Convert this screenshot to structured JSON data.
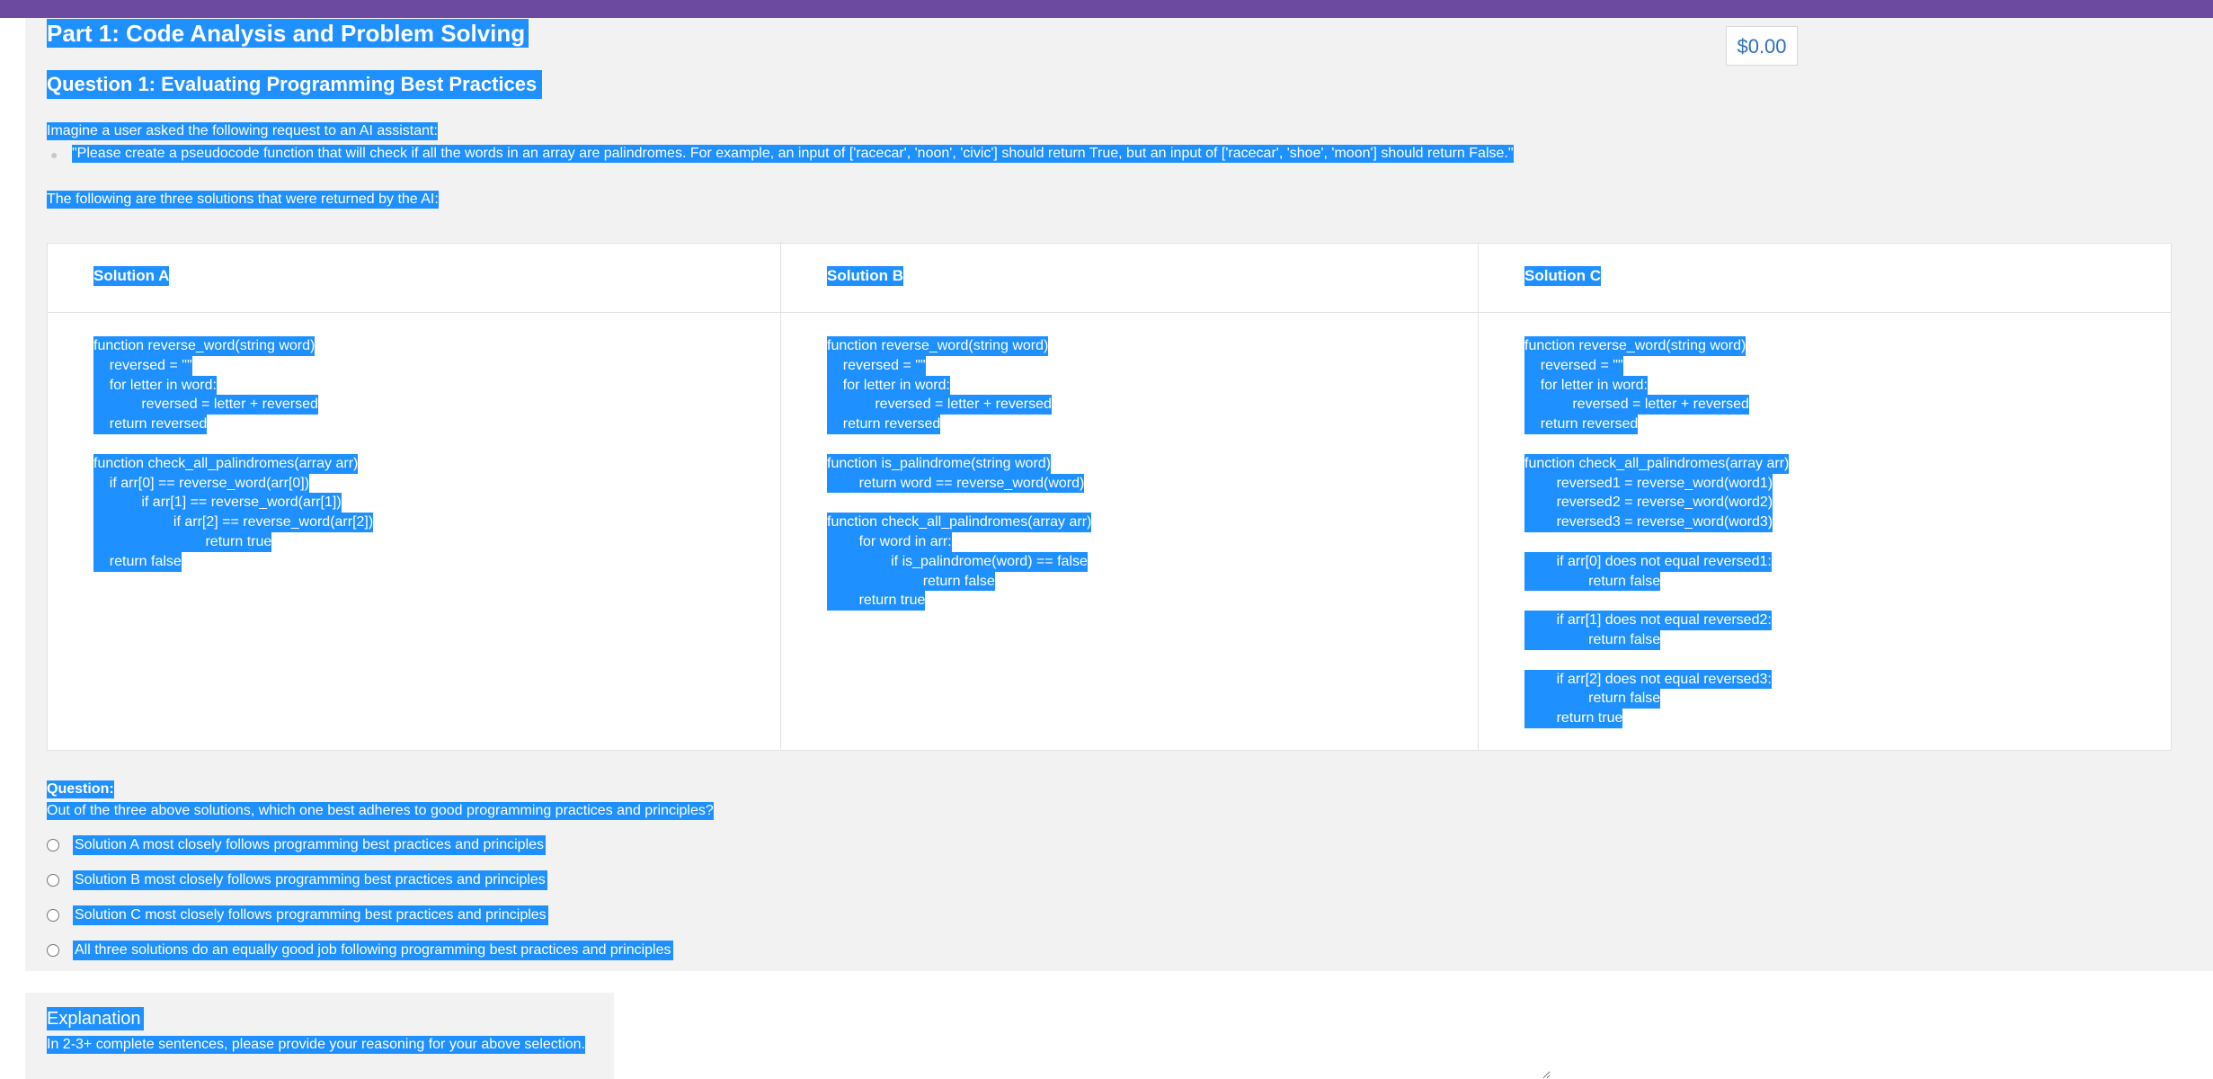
{
  "part_title": "Part 1: Code Analysis and Problem Solving",
  "price": "$0.00",
  "question_title": "Question 1: Evaluating Programming Best Practices",
  "intro": "Imagine a user asked the following request to an AI assistant:",
  "request_quote": "\"Please create a pseudocode function that will check if all the words in an array are palindromes. For example, an input of ['racecar', 'noon', 'civic'] should return True, but an input of ['racecar', 'shoe', 'moon'] should return False.\"",
  "following": "The following are three solutions that were returned by the AI:",
  "solutions": [
    {
      "title": "Solution A",
      "lines": [
        "function reverse_word(string word)",
        "    reversed = \"\"",
        "    for letter in word:",
        "            reversed = letter + reversed",
        "    return reversed",
        "",
        "function check_all_palindromes(array arr)",
        "    if arr[0] == reverse_word(arr[0])",
        "            if arr[1] == reverse_word(arr[1])",
        "                    if arr[2] == reverse_word(arr[2])",
        "                            return true",
        "    return false"
      ]
    },
    {
      "title": "Solution B",
      "lines": [
        "function reverse_word(string word)",
        "    reversed = \"\"",
        "    for letter in word:",
        "            reversed = letter + reversed",
        "    return reversed",
        "",
        "function is_palindrome(string word)",
        "        return word == reverse_word(word)",
        "",
        "function check_all_palindromes(array arr)",
        "        for word in arr:",
        "                if is_palindrome(word) == false",
        "                        return false",
        "        return true"
      ]
    },
    {
      "title": "Solution C",
      "lines": [
        "function reverse_word(string word)",
        "    reversed = \"\"",
        "    for letter in word:",
        "            reversed = letter + reversed",
        "    return reversed",
        "",
        "function check_all_palindromes(array arr)",
        "        reversed1 = reverse_word(word1)",
        "        reversed2 = reverse_word(word2)",
        "        reversed3 = reverse_word(word3)",
        "",
        "        if arr[0] does not equal reversed1:",
        "                return false",
        "",
        "        if arr[1] does not equal reversed2:",
        "                return false",
        "",
        "        if arr[2] does not equal reversed3:",
        "                return false",
        "        return true"
      ]
    }
  ],
  "question_label": "Question:",
  "question_text": "Out of the three above solutions, which one best adheres to good programming practices and principles?",
  "options": [
    "Solution A most closely follows programming best practices and principles",
    "Solution B most closely follows programming best practices and principles",
    "Solution C most closely follows programming best practices and principles",
    "All three solutions do an equally good job following programming best practices and principles"
  ],
  "explanation_title": "Explanation",
  "explanation_hint": "In 2-3+ complete sentences, please provide your reasoning for your above selection."
}
